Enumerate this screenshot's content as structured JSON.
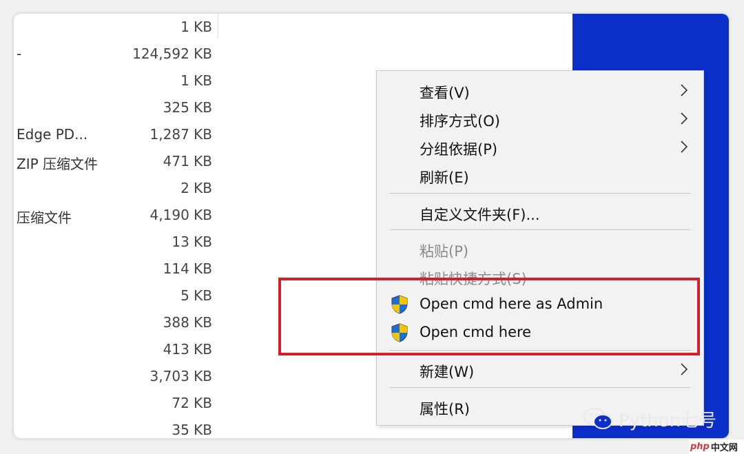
{
  "file_rows": [
    {
      "name": "",
      "size": "1 KB"
    },
    {
      "name": "-",
      "size": "124,592 KB"
    },
    {
      "name": "",
      "size": "1 KB"
    },
    {
      "name": "",
      "size": "325 KB"
    },
    {
      "name": "Edge PD...",
      "size": "1,287 KB"
    },
    {
      "name": "ZIP 压缩文件",
      "size": "471 KB"
    },
    {
      "name": "",
      "size": "2 KB"
    },
    {
      "name": "压缩文件",
      "size": "4,190 KB"
    },
    {
      "name": "",
      "size": "13 KB"
    },
    {
      "name": "",
      "size": "114 KB"
    },
    {
      "name": "",
      "size": "5 KB"
    },
    {
      "name": "",
      "size": "388 KB"
    },
    {
      "name": "",
      "size": "413 KB"
    },
    {
      "name": "",
      "size": "3,703 KB"
    },
    {
      "name": "",
      "size": "72 KB"
    },
    {
      "name": "",
      "size": "35 KB"
    }
  ],
  "context_menu": {
    "view": "查看(V)",
    "sort_by": "排序方式(O)",
    "group_by": "分组依据(P)",
    "refresh": "刷新(E)",
    "customize_folder": "自定义文件夹(F)...",
    "paste": "粘贴(P)",
    "paste_shortcut": "粘贴快捷方式(S)",
    "open_cmd_admin": "Open cmd here as Admin",
    "open_cmd": "Open cmd here",
    "new": "新建(W)",
    "properties": "属性(R)"
  },
  "watermark": {
    "text": "Python七号"
  },
  "site_logo": {
    "part1": "php",
    "part2": "中文网"
  },
  "colors": {
    "highlight": "#d1222c",
    "desktop_blue": "#0b2fc8",
    "menu_bg": "#f2f2f2"
  }
}
